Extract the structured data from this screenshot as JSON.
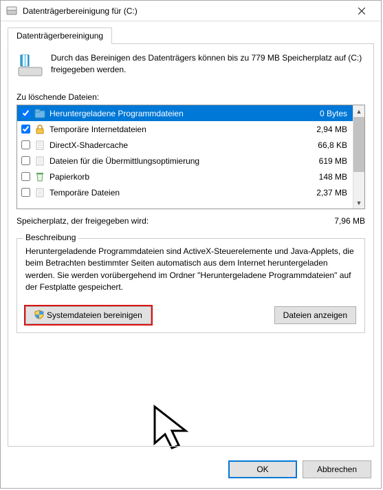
{
  "window": {
    "title": "Datenträgerbereinigung für  (C:)"
  },
  "tabs": {
    "main": "Datenträgerbereinigung"
  },
  "info": "Durch das Bereinigen des Datenträgers können bis zu 779 MB Speicherplatz auf  (C:) freigegeben werden.",
  "list": {
    "heading": "Zu löschende Dateien:",
    "items": [
      {
        "checked": true,
        "icon": "folder",
        "name": "Heruntergeladene Programmdateien",
        "size": "0 Bytes",
        "selected": true
      },
      {
        "checked": true,
        "icon": "lock",
        "name": "Temporäre Internetdateien",
        "size": "2,94 MB",
        "selected": false
      },
      {
        "checked": false,
        "icon": "page",
        "name": "DirectX-Shadercache",
        "size": "66,8 KB",
        "selected": false
      },
      {
        "checked": false,
        "icon": "page",
        "name": "Dateien für die Übermittlungsoptimierung",
        "size": "619 MB",
        "selected": false
      },
      {
        "checked": false,
        "icon": "recycle",
        "name": "Papierkorb",
        "size": "148 MB",
        "selected": false
      },
      {
        "checked": false,
        "icon": "page",
        "name": "Temporäre Dateien",
        "size": "2,37 MB",
        "selected": false
      }
    ]
  },
  "space": {
    "label": "Speicherplatz, der freigegeben wird:",
    "value": "7,96 MB"
  },
  "description": {
    "heading": "Beschreibung",
    "text": "Heruntergeladende Programmdateien sind ActiveX-Steuerelemente und Java-Applets, die beim Betrachten bestimmter Seiten automatisch aus dem Internet heruntergeladen werden. Sie werden vorübergehend im Ordner \"Heruntergeladene Programmdateien\" auf der Festplatte gespeichert."
  },
  "buttons": {
    "cleanup_system": "Systemdateien bereinigen",
    "view_files": "Dateien anzeigen",
    "ok": "OK",
    "cancel": "Abbrechen"
  }
}
